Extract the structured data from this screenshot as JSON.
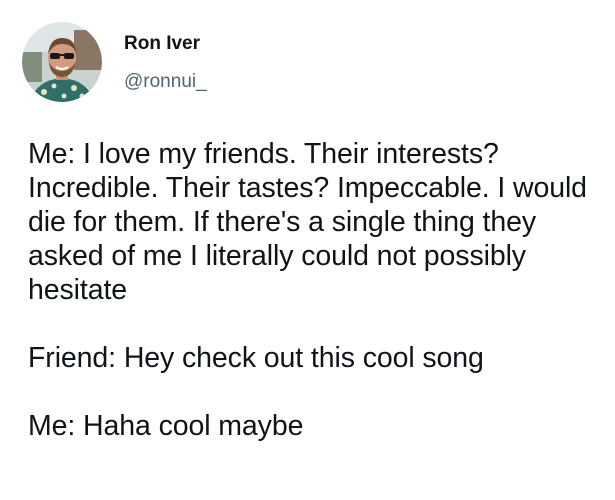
{
  "author": {
    "display_name": "Ron Iver",
    "handle": "@ronnui_"
  },
  "tweet": {
    "paragraphs": [
      "Me: I love my friends. Their interests? Incredible. Their tastes? Impeccable. I would die for them. If there's a single thing they asked of me I literally could not possibly hesitate",
      "Friend: Hey check out this cool song",
      "Me: Haha cool maybe"
    ]
  },
  "colors": {
    "text": "#0f1419",
    "secondary_text": "#536471",
    "background": "#ffffff"
  }
}
